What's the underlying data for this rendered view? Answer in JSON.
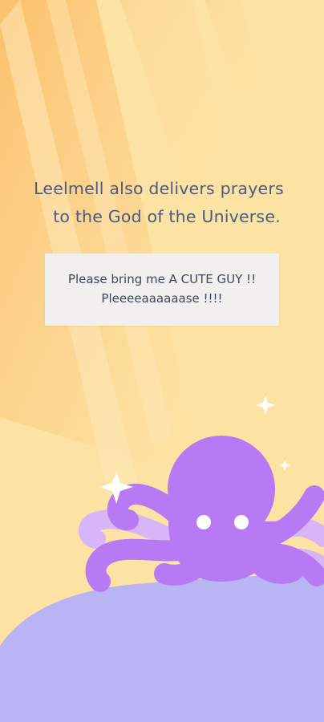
{
  "caption": {
    "line1": "Leelmell also delivers prayers",
    "line2": "to the God of the Universe."
  },
  "note": {
    "line1": "Please bring me A CUTE GUY !!",
    "line2": "Pleeeeaaaaaase !!!!"
  },
  "colors": {
    "background": "#fde3a3",
    "light_rays": "#fbc978",
    "caption_text": "#4b5a86",
    "note_card": "#f1f0ee",
    "octopus_body": "#b879f5",
    "octopus_back_tentacles": "#d8b5f7",
    "planet": "#b9b4f3",
    "sparkle": "#ffffff"
  },
  "icons": [
    "light-rays",
    "sparkle-icon",
    "octopus-mascot",
    "planet-hill"
  ]
}
